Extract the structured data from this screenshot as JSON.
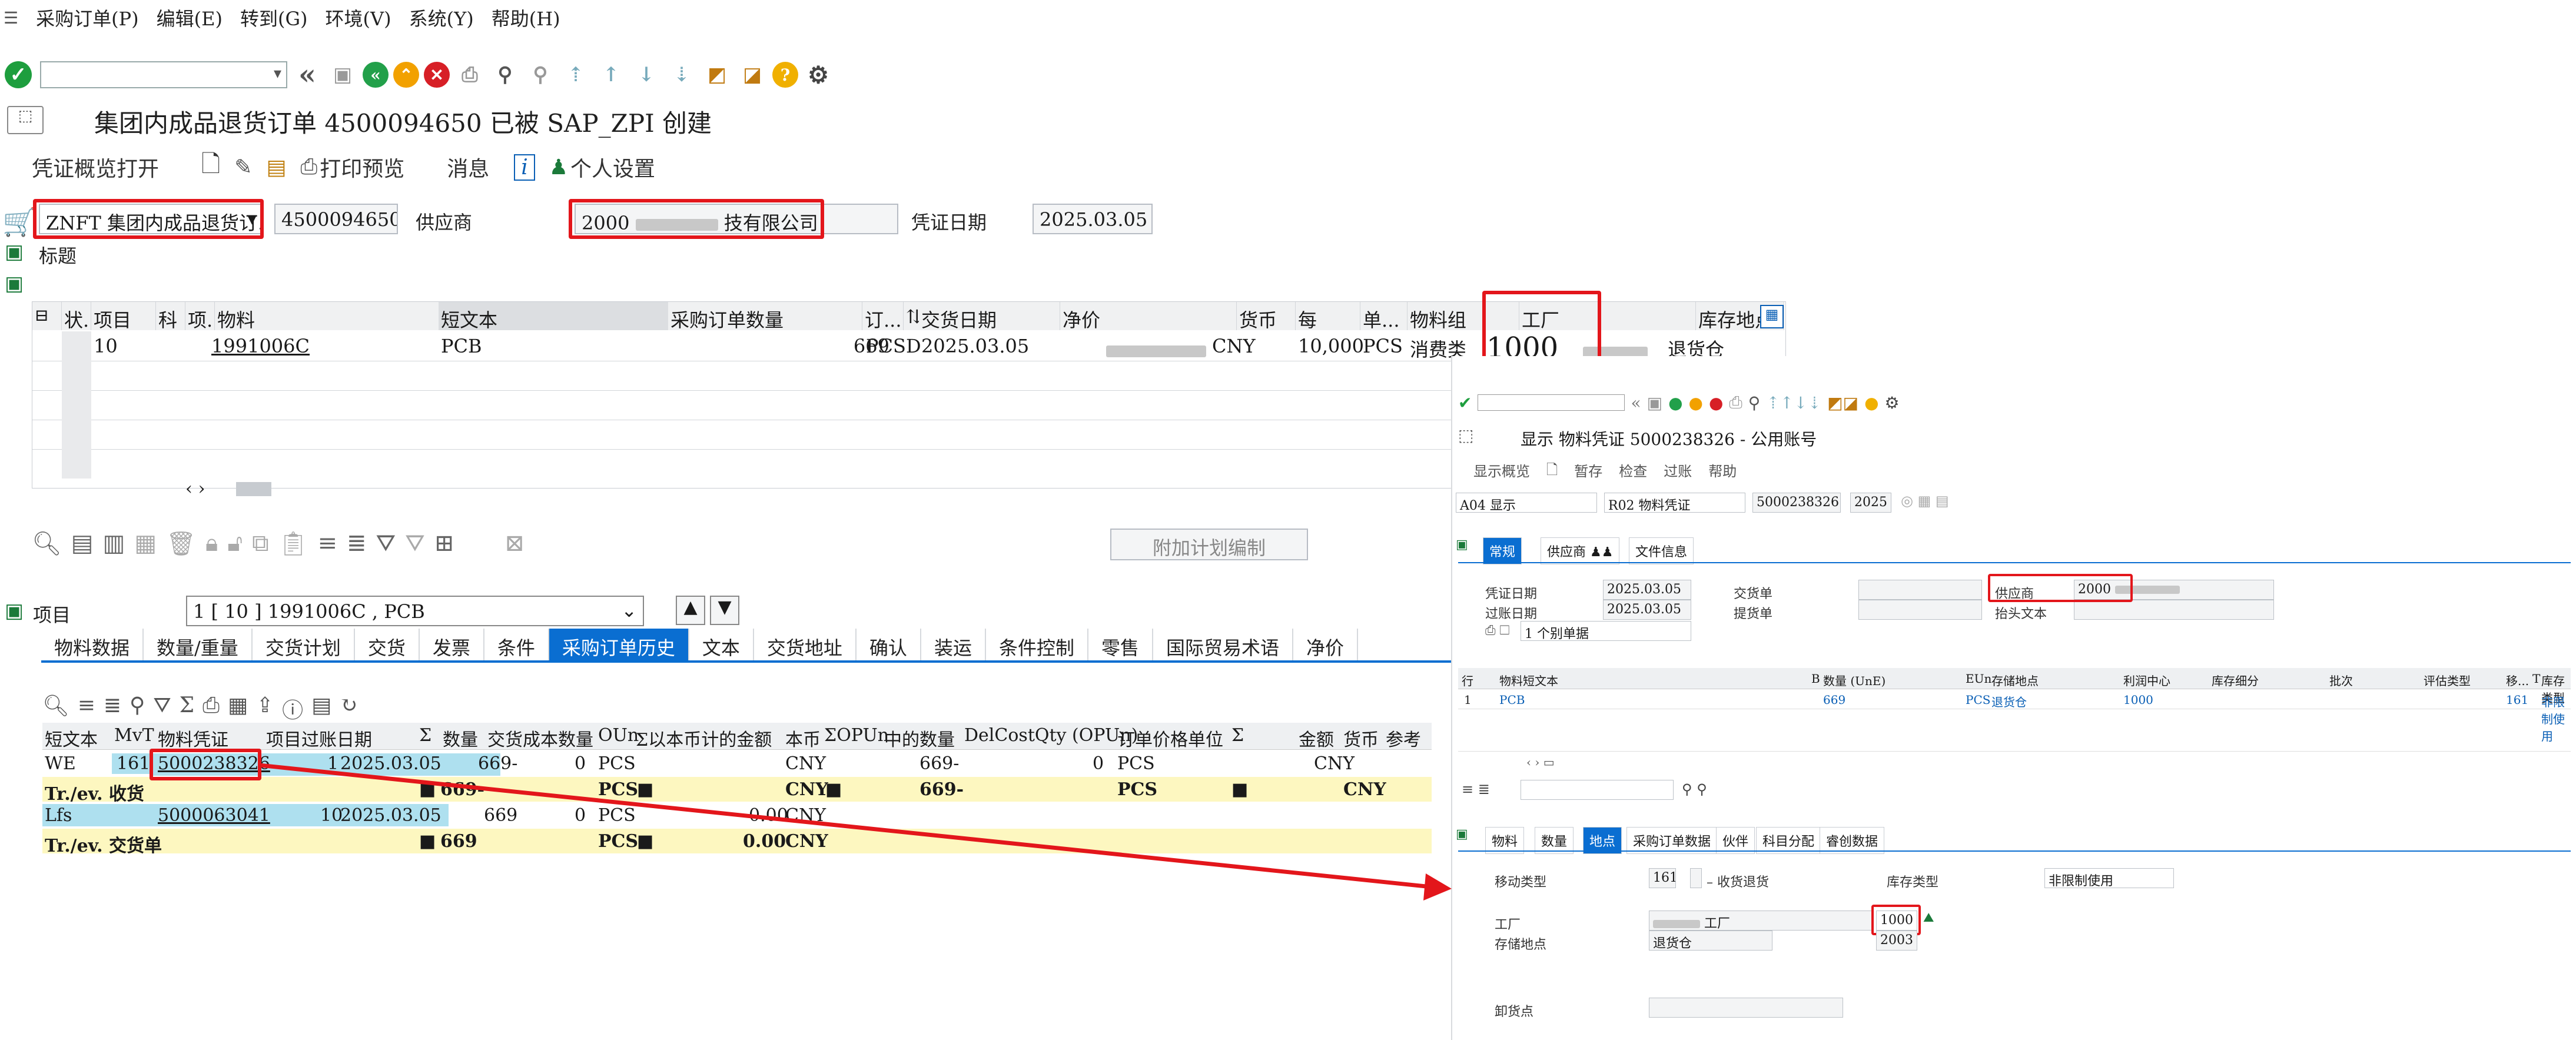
{
  "menu": {
    "items": [
      "采购订单(P)",
      "编辑(E)",
      "转到(G)",
      "环境(V)",
      "系统(Y)",
      "帮助(H)"
    ]
  },
  "title": "集团内成品退货订单 4500094650 已被 SAP_ZPI 创建",
  "app_toolbar": {
    "overview": "凭证概览打开",
    "print_preview": "打印预览",
    "messages": "消息",
    "personal": "个人设置"
  },
  "header": {
    "order_type": "ZNFT 集团内成品退货订...",
    "po_number": "4500094650",
    "vendor_label": "供应商",
    "vendor_value": "2000",
    "vendor_suffix": "技有限公司",
    "doc_date_label": "凭证日期",
    "doc_date": "2025.03.05",
    "header_label": "标题"
  },
  "items_table": {
    "columns": [
      "状.",
      "项目",
      "科",
      "项.",
      "物料",
      "短文本",
      "采购订单数量",
      "订...",
      "D",
      "交货日期",
      "净价",
      "货币",
      "每",
      "单...",
      "物料组",
      "工厂",
      "库存地点"
    ],
    "row": {
      "item": "10",
      "material": "1991006C",
      "short_text": "PCB",
      "qty": "669",
      "unit": "PCS",
      "d": "D",
      "delivery_date": "2025.03.05",
      "currency": "CNY",
      "per": "10,000",
      "unit2": "PCS",
      "mat_group": "消费类",
      "plant": "1000",
      "storage": "退货仓"
    }
  },
  "add_plan_btn": "附加计划编制",
  "item_detail": {
    "label": "项目",
    "selector": "1 [ 10 ] 1991006C , PCB"
  },
  "detail_tabs": [
    "物料数据",
    "数量/重量",
    "交货计划",
    "交货",
    "发票",
    "条件",
    "采购订单历史",
    "文本",
    "交货地址",
    "确认",
    "装运",
    "条件控制",
    "零售",
    "国际贸易术语",
    "净价"
  ],
  "history": {
    "headers": [
      "短文本",
      "MvT",
      "物料凭证",
      "项目",
      "过账日期",
      "Σ",
      "数量",
      "交货成本数量",
      "OUn",
      "Σ以本币计的金额",
      "本币",
      "ΣOPUn",
      "中的数量",
      "DelCostQty (OPUn)",
      "订单价格单位",
      "Σ",
      "金额",
      "货币",
      "参考"
    ],
    "rows": [
      {
        "type": "WE",
        "mvt": "161",
        "doc": "5000238326",
        "item": "1",
        "date": "2025.03.05",
        "qty": "669-",
        "dcq": "0",
        "oun": "PCS",
        "lc": "CNY",
        "opun_qty": "669-",
        "delcost": "0",
        "opu": "PCS",
        "cur": "CNY"
      },
      {
        "type": "Tr./ev. 收货",
        "qty": "669-",
        "oun": "PCS",
        "lc": "CNY",
        "opun_qty": "669-",
        "opu": "PCS",
        "cur": "CNY"
      },
      {
        "type": "Lfs",
        "doc": "5000063041",
        "item": "10",
        "date": "2025.03.05",
        "qty": "669",
        "dcq": "0",
        "oun": "PCS",
        "amount": "0.00",
        "lc": "CNY"
      },
      {
        "type": "Tr./ev. 交货单",
        "qty": "669",
        "oun": "PCS",
        "amount": "0.00",
        "lc": "CNY"
      }
    ]
  },
  "right": {
    "title": "显示 物料凭证 5000238326 - 公用账号",
    "toolbar": {
      "overview": "显示概览",
      "hold": "暂存",
      "check": "检查",
      "post": "过账",
      "help": "帮助"
    },
    "selectors": {
      "action": "A04 显示",
      "ref": "R02 物料凭证",
      "doc_no": "5000238326",
      "year": "2025"
    },
    "tabs": [
      "常规",
      "供应商",
      "文件信息"
    ],
    "general": {
      "doc_date_label": "凭证日期",
      "doc_date": "2025.03.05",
      "post_date_label": "过账日期",
      "post_date": "2025.03.05",
      "delivery_label": "交货单",
      "bol_label": "提货单",
      "vendor_label": "供应商",
      "vendor_value": "2000",
      "header_text_label": "抬头文本",
      "slip": "1 个别单据"
    },
    "item_cols": [
      "行",
      "物料短文本",
      "B",
      "数量 (UnE)",
      "EUn",
      "存储地点",
      "利润中心",
      "库存细分",
      "批次",
      "评估类型",
      "移...",
      "T",
      "库存类型"
    ],
    "item_row": {
      "line": "1",
      "text": "PCB",
      "qty": "669",
      "eun": "PCS",
      "sloc": "退货仓",
      "pc": "1000",
      "mvt": "161",
      "stype": "非限制使用"
    },
    "detail_tabs": [
      "物料",
      "数量",
      "地点",
      "采购订单数据",
      "伙伴",
      "科目分配",
      "睿创数据"
    ],
    "detail": {
      "mvt_label": "移动类型",
      "mvt": "161",
      "mvt_text": "收货退货",
      "stock_type_label": "库存类型",
      "stock_type": "非限制使用",
      "plant_label": "工厂",
      "plant_suffix": "工厂",
      "plant": "1000",
      "sloc_label": "存储地点",
      "sloc": "退货仓",
      "sloc_code": "2003",
      "unload_label": "卸货点"
    }
  }
}
